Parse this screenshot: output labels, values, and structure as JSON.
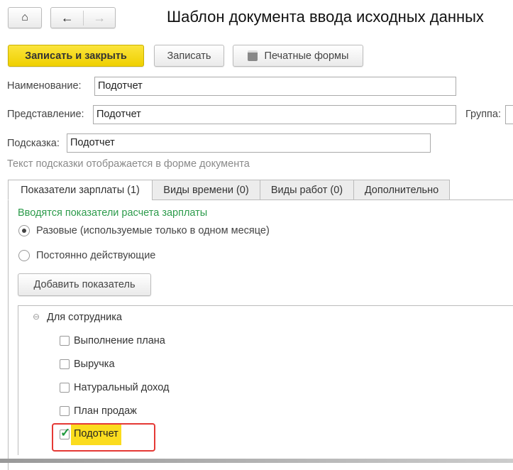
{
  "title": "Шаблон документа ввода исходных данных",
  "toolbar": {
    "save_close": "Записать и закрыть",
    "save": "Записать",
    "print": "Печатные формы"
  },
  "fields": {
    "name_label": "Наименование:",
    "name_value": "Подотчет",
    "view_label": "Представление:",
    "view_value": "Подотчет",
    "group_label": "Группа:",
    "hint_label": "Подсказка:",
    "hint_value": "Подотчет",
    "hint_note": "Текст подсказки отображается в форме документа"
  },
  "tabs": [
    {
      "label": "Показатели зарплаты (1)",
      "active": true
    },
    {
      "label": "Виды времени (0)"
    },
    {
      "label": "Виды работ (0)"
    },
    {
      "label": "Дополнительно"
    }
  ],
  "panel": {
    "heading": "Вводятся показатели расчета зарплаты",
    "radio_once": "Разовые (используемые только в одном месяце)",
    "radio_permanent": "Постоянно действующие",
    "selected": "once",
    "add_button": "Добавить показатель"
  },
  "tree": {
    "group": "Для сотрудника",
    "items": [
      {
        "label": "Выполнение плана",
        "checked": false
      },
      {
        "label": "Выручка",
        "checked": false
      },
      {
        "label": "Натуральный доход",
        "checked": false
      },
      {
        "label": "План продаж",
        "checked": false
      },
      {
        "label": "Подотчет",
        "checked": true
      }
    ]
  },
  "colors": {
    "accent": "#f5d800",
    "green": "#2c9b4b",
    "highlight": "#fbdc1e",
    "annotation": "#e53935"
  }
}
